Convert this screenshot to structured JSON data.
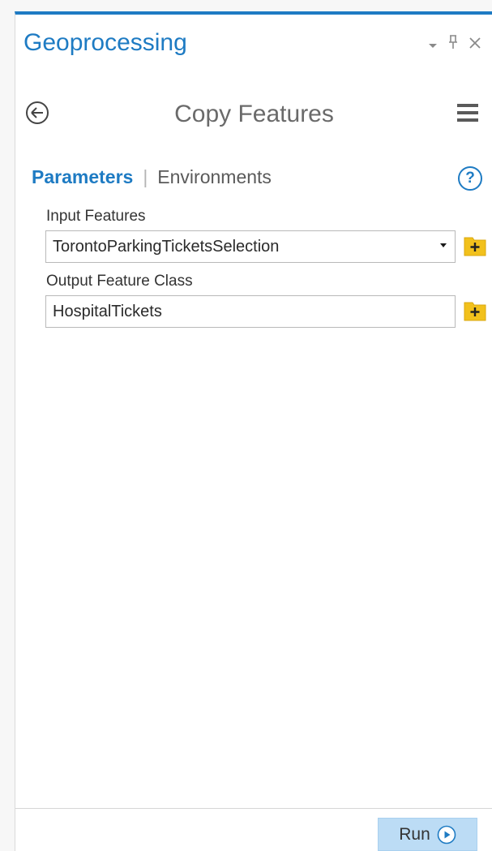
{
  "pane": {
    "title": "Geoprocessing",
    "controls": {
      "options_icon": "dropdown-arrow-icon",
      "pin_icon": "pin-icon",
      "close_icon": "close-icon",
      "dropdown_glyph": "▾",
      "pin_glyph": "ᵖ",
      "close_glyph": "×"
    }
  },
  "tool": {
    "title": "Copy Features",
    "back_icon": "back-arrow-icon",
    "menu_icon": "hamburger-menu-icon"
  },
  "tabs": {
    "parameters": "Parameters",
    "separator": "|",
    "environments": "Environments",
    "help": "?"
  },
  "parameters": [
    {
      "label": "Input Features",
      "value": "TorontoParkingTicketsSelection",
      "has_dropdown": true
    },
    {
      "label": "Output Feature Class",
      "value": "HospitalTickets",
      "has_dropdown": false
    }
  ],
  "footer": {
    "run_label": "Run"
  },
  "colors": {
    "accent": "#1e7bc3",
    "run_button_bg": "#bcdcf5",
    "folder_icon": "#f2c11c"
  }
}
